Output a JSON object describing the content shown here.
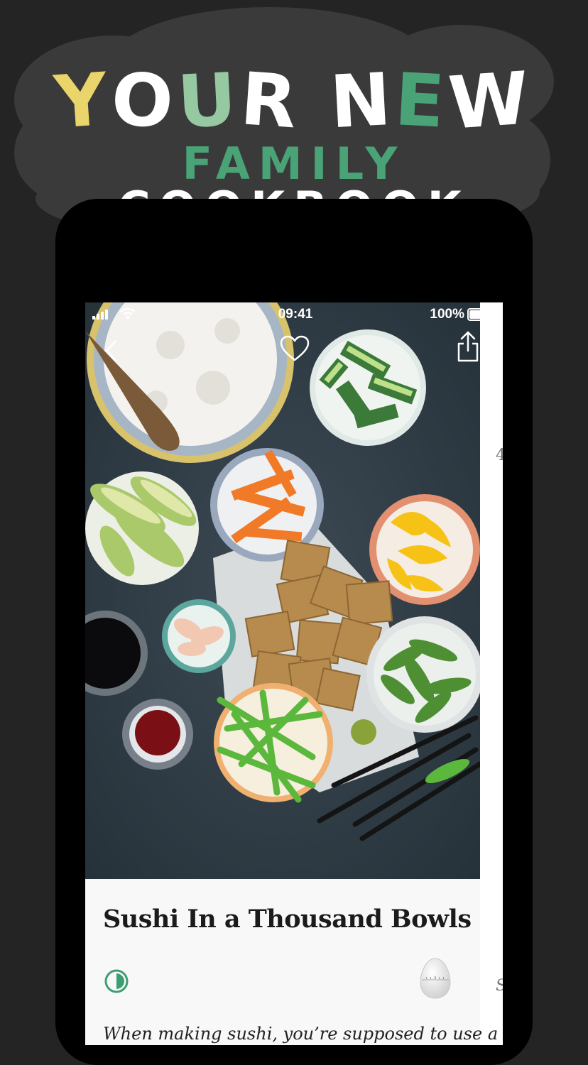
{
  "banner": {
    "line1": [
      {
        "ch": "Y",
        "color": "#e9d56a"
      },
      {
        "ch": "O",
        "color": "#ffffff"
      },
      {
        "ch": "U",
        "color": "#96c8a2"
      },
      {
        "ch": "R",
        "color": "#ffffff"
      },
      {
        "ch": " ",
        "color": "#ffffff"
      },
      {
        "ch": "N",
        "color": "#ffffff"
      },
      {
        "ch": "E",
        "color": "#4aa277"
      },
      {
        "ch": "W",
        "color": "#ffffff"
      }
    ],
    "line2_part1": "FAMILY",
    "line2_part2": "COOKBOOK",
    "line2_part1_color": "#4aa277",
    "line2_part2_color": "#ffffff"
  },
  "status_bar": {
    "time": "09:41",
    "battery": "100%"
  },
  "nav": {
    "back_icon": "chevron-left-icon",
    "favorite_icon": "heart-icon",
    "share_icon": "share-icon"
  },
  "side_card": {
    "top_fragment": "4",
    "bottom_fragment": "S"
  },
  "recipe": {
    "title": "Sushi In a Thousand Bowls",
    "description": "When making sushi, you’re supposed to use a",
    "difficulty_icon": "half-circle-icon",
    "timer_icon": "egg-timer-icon",
    "accent": "#3d9e72"
  }
}
